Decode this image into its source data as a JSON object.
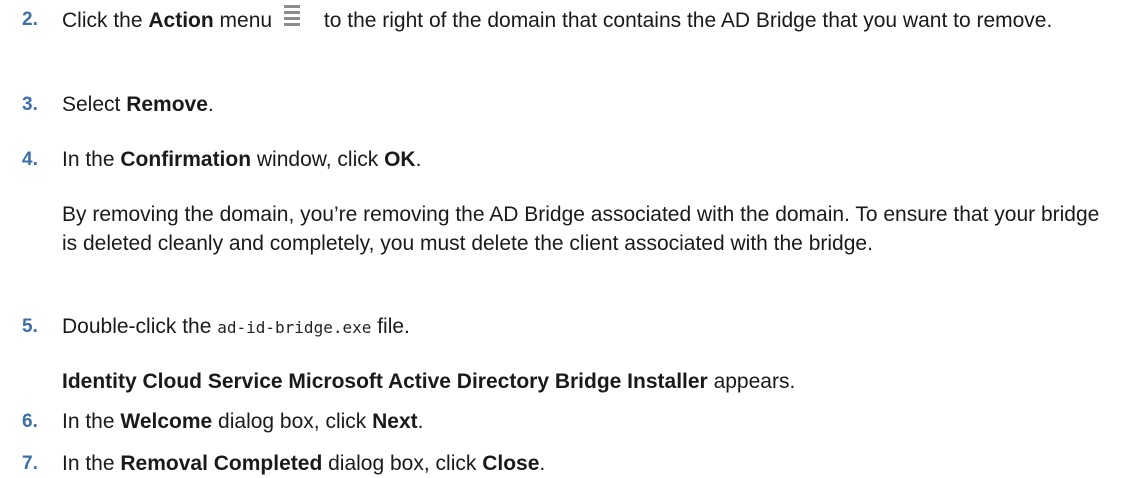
{
  "steps": [
    {
      "number": "2.",
      "a": "Click the ",
      "b": "Action",
      "c": " menu",
      "d": " to the right of the domain that contains the AD Bridge that you want to remove.",
      "icon": "hamburger-menu-icon"
    },
    {
      "number": "3.",
      "a": "Select ",
      "b": "Remove",
      "c": "."
    },
    {
      "number": "4.",
      "a": "In the ",
      "b": "Confirmation",
      "c": " window, click ",
      "d": "OK",
      "e": "."
    },
    {
      "number": "5.",
      "a": "Double-click the ",
      "code": "ad-id-bridge.exe",
      "c": " file."
    },
    {
      "number": "6.",
      "a": "In the ",
      "b": "Welcome",
      "c": " dialog box, click ",
      "d": "Next",
      "e": "."
    },
    {
      "number": "7.",
      "a": "In the ",
      "b": "Removal Completed",
      "c": " dialog box, click ",
      "d": "Close",
      "e": "."
    }
  ],
  "notes": {
    "after_step4": "By removing the domain, you’re removing the AD Bridge associated with the domain. To ensure that your bridge is deleted cleanly and completely, you must delete the client associated with the bridge.",
    "after_step5": {
      "b": "Identity Cloud Service Microsoft Active Directory Bridge Installer",
      "c": " appears."
    }
  },
  "colors": {
    "step_number": "#3d6fa8",
    "text": "#1a1a1a",
    "icon": "#8c8c8c"
  }
}
